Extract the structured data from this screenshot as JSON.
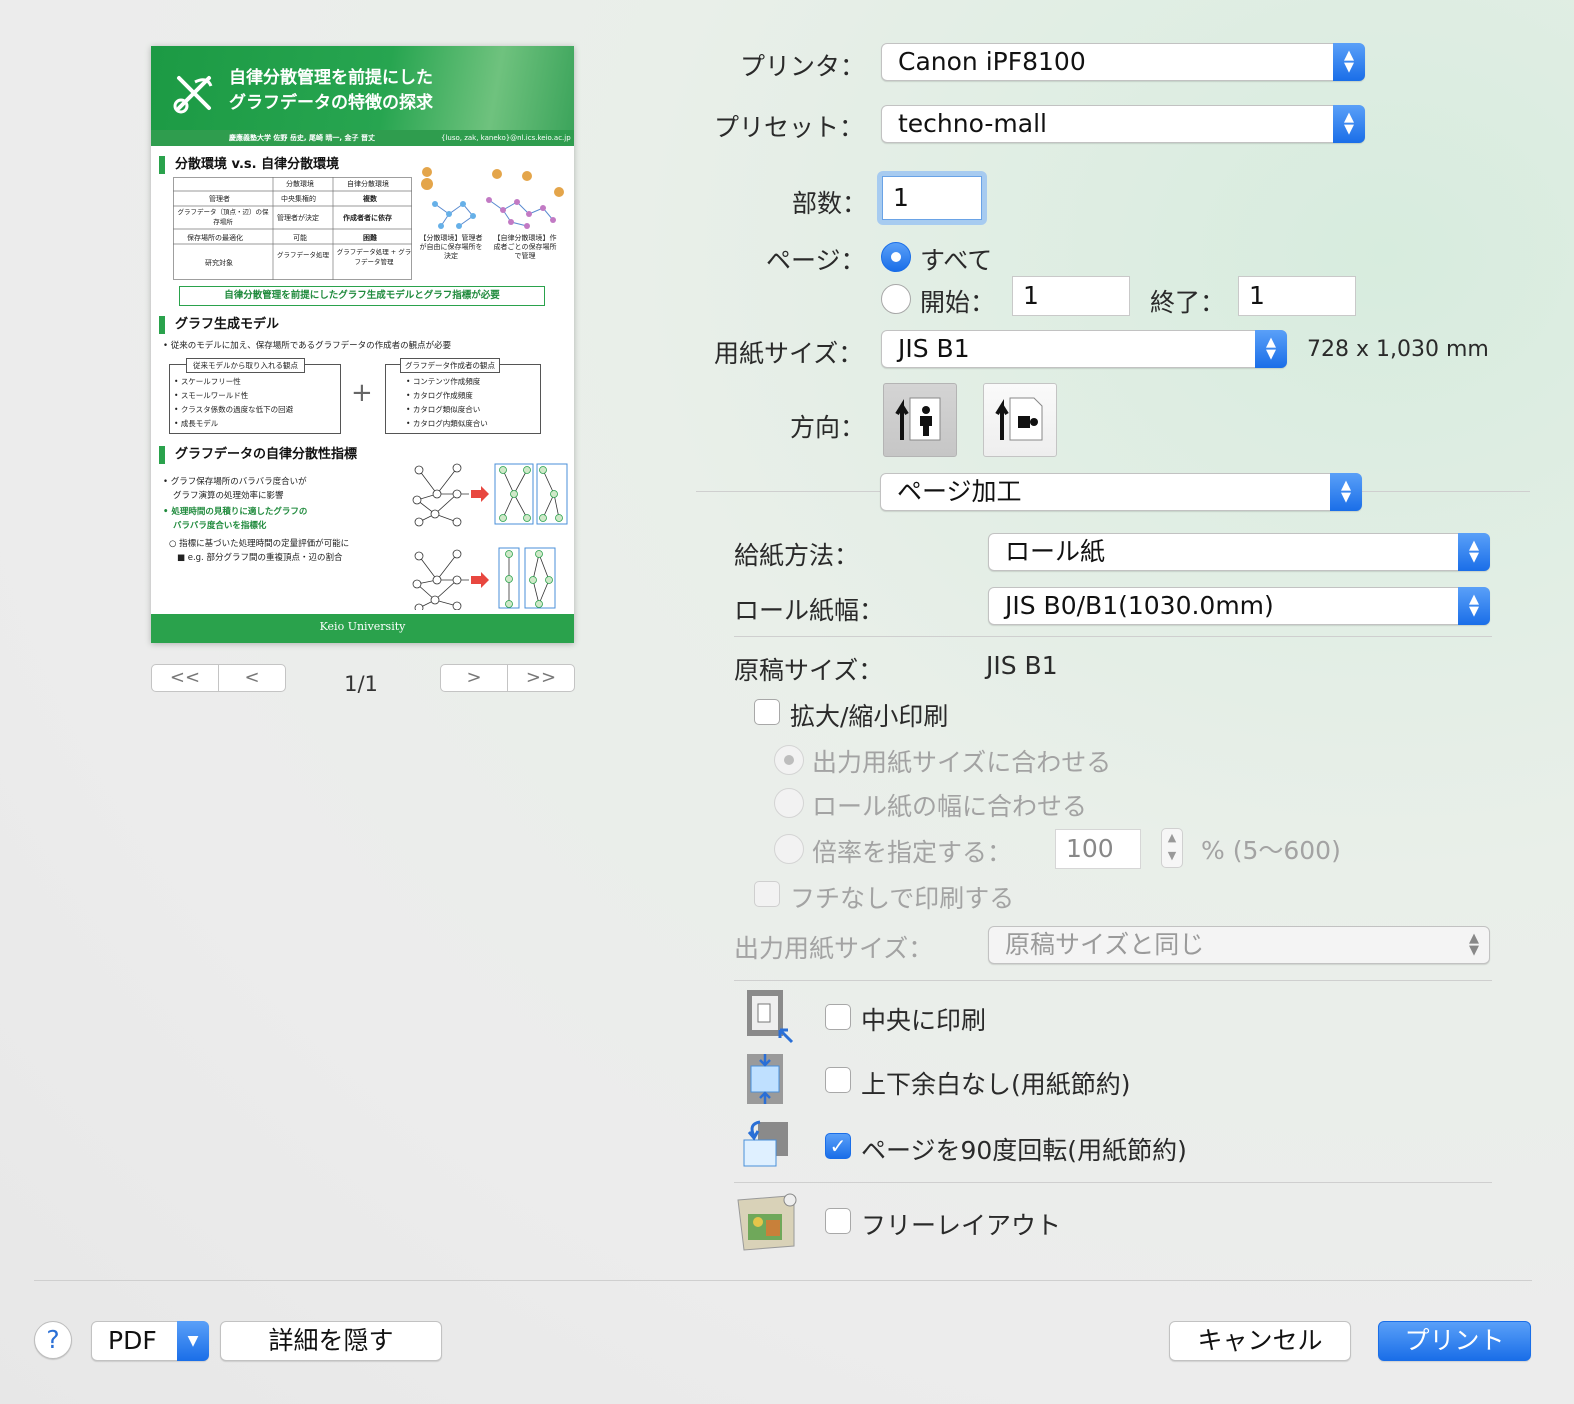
{
  "preview": {
    "title_line1": "自律分散管理を前提にした",
    "title_line2": "グラフデータの特徴の探求",
    "authors": "慶應義塾大学 佐野 岳史, 尾崎 晴一, 金子 晋丈",
    "emails": "{luso, zak, kaneko}@nl.ics.keio.ac.jp",
    "sec1": "分散環境 v.s. 自律分散環境",
    "table_headers": [
      "",
      "分散環境",
      "自律分散環境"
    ],
    "table_rows": [
      [
        "管理者",
        "中央集権的",
        "複数"
      ],
      [
        "グラフデータ（頂点・辺）の保存場所",
        "管理者が決定",
        "作成者者に依存"
      ],
      [
        "保存場所の最適化",
        "可能",
        "困難"
      ],
      [
        "研究対象",
        "グラフデータ処理",
        "グラフデータ処理 + グラフデータ管理"
      ]
    ],
    "cap_left": "【分散環境】管理者が自由に保存場所を決定",
    "cap_right": "【自律分散環境】作成者ごとの保存場所で管理",
    "banner": "自律分散管理を前提にしたグラフ生成モデルとグラフ指標が必要",
    "sec2": "グラフ生成モデル",
    "sec2_bullet": "従来のモデルに加え、保存場所であるグラフデータの作成者の観点が必要",
    "box_left_title": "従来モデルから取り入れる観点",
    "box_left_items": [
      "スケールフリー性",
      "スモールワールド性",
      "クラスタ係数の過度な低下の回避",
      "成長モデル"
    ],
    "box_right_title": "グラフデータ作成者の観点",
    "box_right_items": [
      "コンテンツ作成頻度",
      "カタログ作成頻度",
      "カタログ類似度合い",
      "カタログ内類似度合い"
    ],
    "sec3": "グラフデータの自律分散性指標",
    "sec3_b1": "グラフ保存場所のバラバラ度合いが",
    "sec3_b1b": "グラフ演算の処理効率に影響",
    "sec3_b2": "処理時間の見積りに適したグラフの",
    "sec3_b2b": "バラバラ度合いを指標化",
    "sec3_b3": "指標に基づいた処理時間の定量評価が可能に",
    "sec3_b4": "e.g. 部分グラフ間の重複頂点・辺の割合",
    "footer": "Keio University",
    "page_indicator": "1/1",
    "nav": [
      "<<",
      "<",
      ">",
      ">>"
    ]
  },
  "printer": {
    "label": "プリンタ：",
    "value": "Canon iPF8100"
  },
  "preset": {
    "label": "プリセット：",
    "value": "techno-mall"
  },
  "copies": {
    "label": "部数：",
    "value": "1"
  },
  "pages": {
    "label": "ページ：",
    "all": "すべて",
    "from_label": "開始：",
    "from_value": "1",
    "to_label": "終了：",
    "to_value": "1"
  },
  "paper_size": {
    "label": "用紙サイズ：",
    "value": "JIS B1",
    "dims": "728 x 1,030 mm"
  },
  "orientation": {
    "label": "方向："
  },
  "section_popup": "ページ加工",
  "feed": {
    "label": "給紙方法：",
    "value": "ロール紙"
  },
  "roll_width": {
    "label": "ロール紙幅：",
    "value": "JIS B0/B1(1030.0mm)"
  },
  "original_size": {
    "label": "原稿サイズ：",
    "value": "JIS B1"
  },
  "scale": {
    "label": "拡大/縮小印刷",
    "opt_fit_output": "出力用紙サイズに合わせる",
    "opt_fit_roll": "ロール紙の幅に合わせる",
    "opt_ratio": "倍率を指定する：",
    "ratio_value": "100",
    "ratio_range": "% (5〜600)"
  },
  "borderless": "フチなしで印刷する",
  "output_size": {
    "label": "出力用紙サイズ：",
    "value": "原稿サイズと同じ"
  },
  "options": {
    "center": "中央に印刷",
    "no_margin": "上下余白なし(用紙節約)",
    "rotate": "ページを90度回転(用紙節約)",
    "free_layout": "フリーレイアウト"
  },
  "bottom": {
    "help": "?",
    "pdf": "PDF",
    "hide_details": "詳細を隠す",
    "cancel": "キャンセル",
    "print": "プリント"
  },
  "colors": {
    "accent": "#1a6ee8",
    "poster_green": "#2aa24c"
  }
}
